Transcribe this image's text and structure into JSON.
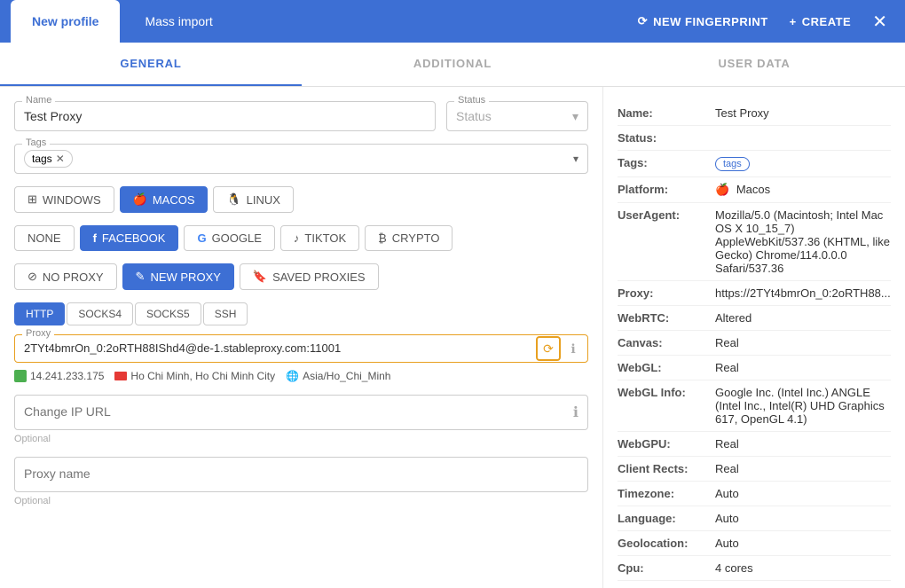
{
  "header": {
    "tab_active": "New profile",
    "tab_inactive": "Mass import",
    "new_fingerprint_label": "NEW FINGERPRINT",
    "create_label": "CREATE"
  },
  "nav_tabs": {
    "general": "GENERAL",
    "additional": "ADDITIONAL",
    "user_data": "USER DATA"
  },
  "form": {
    "name_label": "Name",
    "name_value": "Test Proxy",
    "status_placeholder": "Status",
    "tags_label": "Tags",
    "tag_value": "tags"
  },
  "platform_buttons": [
    {
      "label": "WINDOWS",
      "icon": "⊞",
      "active": false
    },
    {
      "label": "MACOS",
      "icon": "🍎",
      "active": true
    },
    {
      "label": "LINUX",
      "icon": "🐧",
      "active": false
    }
  ],
  "cookie_buttons": [
    {
      "label": "NONE",
      "active": false
    },
    {
      "label": "FACEBOOK",
      "icon": "f",
      "active": true
    },
    {
      "label": "GOOGLE",
      "icon": "G",
      "active": false
    },
    {
      "label": "TIKTOK",
      "icon": "♪",
      "active": false
    },
    {
      "label": "CRYPTO",
      "icon": "₿",
      "active": false
    }
  ],
  "proxy_buttons": [
    {
      "label": "NO PROXY",
      "active": false
    },
    {
      "label": "NEW PROXY",
      "active": true
    },
    {
      "label": "SAVED PROXIES",
      "active": false
    }
  ],
  "proto_tabs": [
    {
      "label": "HTTP",
      "active": true
    },
    {
      "label": "SOCKS4",
      "active": false
    },
    {
      "label": "SOCKS5",
      "active": false
    },
    {
      "label": "SSH",
      "active": false
    }
  ],
  "proxy": {
    "label": "Proxy",
    "value": "2TYt4bmrOn_0:2oRTH88IShd4@de-1.stableproxy.com:11001",
    "ip": "14.241.233.175",
    "city": "Ho Chi Minh, Ho Chi Minh City",
    "timezone": "Asia/Ho_Chi_Minh"
  },
  "change_ip_url": {
    "placeholder": "Change IP URL",
    "optional": "Optional"
  },
  "proxy_name": {
    "placeholder": "Proxy name",
    "optional": "Optional"
  },
  "info_panel": {
    "name_label": "Name:",
    "name_value": "Test Proxy",
    "status_label": "Status:",
    "status_value": "",
    "tags_label": "Tags:",
    "tag_value": "tags",
    "platform_label": "Platform:",
    "platform_value": "Macos",
    "useragent_label": "UserAgent:",
    "useragent_value": "Mozilla/5.0 (Macintosh; Intel Mac OS X 10_15_7) AppleWebKit/537.36 (KHTML, like Gecko) Chrome/114.0.0.0 Safari/537.36",
    "proxy_label": "Proxy:",
    "proxy_value": "https://2TYt4bmrOn_0:2oRTH88...",
    "webrtc_label": "WebRTC:",
    "webrtc_value": "Altered",
    "canvas_label": "Canvas:",
    "canvas_value": "Real",
    "webgl_label": "WebGL:",
    "webgl_value": "Real",
    "webglinfo_label": "WebGL Info:",
    "webglinfo_value": "Google Inc. (Intel Inc.) ANGLE (Intel Inc., Intel(R) UHD Graphics 617, OpenGL 4.1)",
    "webgpu_label": "WebGPU:",
    "webgpu_value": "Real",
    "clientrects_label": "Client Rects:",
    "clientrects_value": "Real",
    "timezone_label": "Timezone:",
    "timezone_value": "Auto",
    "language_label": "Language:",
    "language_value": "Auto",
    "geolocation_label": "Geolocation:",
    "geolocation_value": "Auto",
    "cpu_label": "Cpu:",
    "cpu_value": "4 cores"
  }
}
